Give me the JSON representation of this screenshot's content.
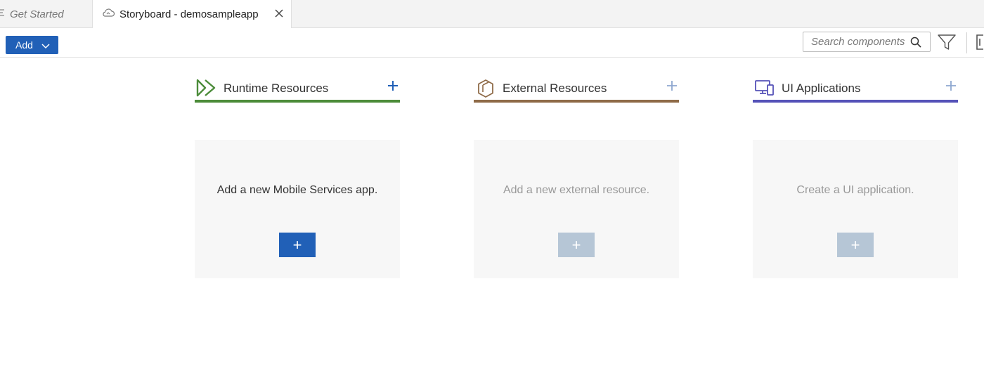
{
  "tabs": [
    {
      "label": "Get Started",
      "active": false
    },
    {
      "label": "Storyboard - demosampleapp",
      "active": true
    }
  ],
  "toolbar": {
    "add_label": "Add",
    "search_placeholder": "Search components"
  },
  "columns": [
    {
      "title": "Runtime Resources",
      "accent": "#4c8c3a",
      "card_text": "Add a new Mobile Services app.",
      "button_label": "+",
      "button_enabled": true
    },
    {
      "title": "External Resources",
      "accent": "#8f6b48",
      "card_text": "Add a new external resource.",
      "button_label": "+",
      "button_enabled": false
    },
    {
      "title": "UI Applications",
      "accent": "#5552b8",
      "card_text": "Create a UI application.",
      "button_label": "+",
      "button_enabled": false
    }
  ],
  "colors": {
    "primary": "#2160b7",
    "disabled_button": "#b6c6d6",
    "card_bg": "#f7f7f7"
  }
}
